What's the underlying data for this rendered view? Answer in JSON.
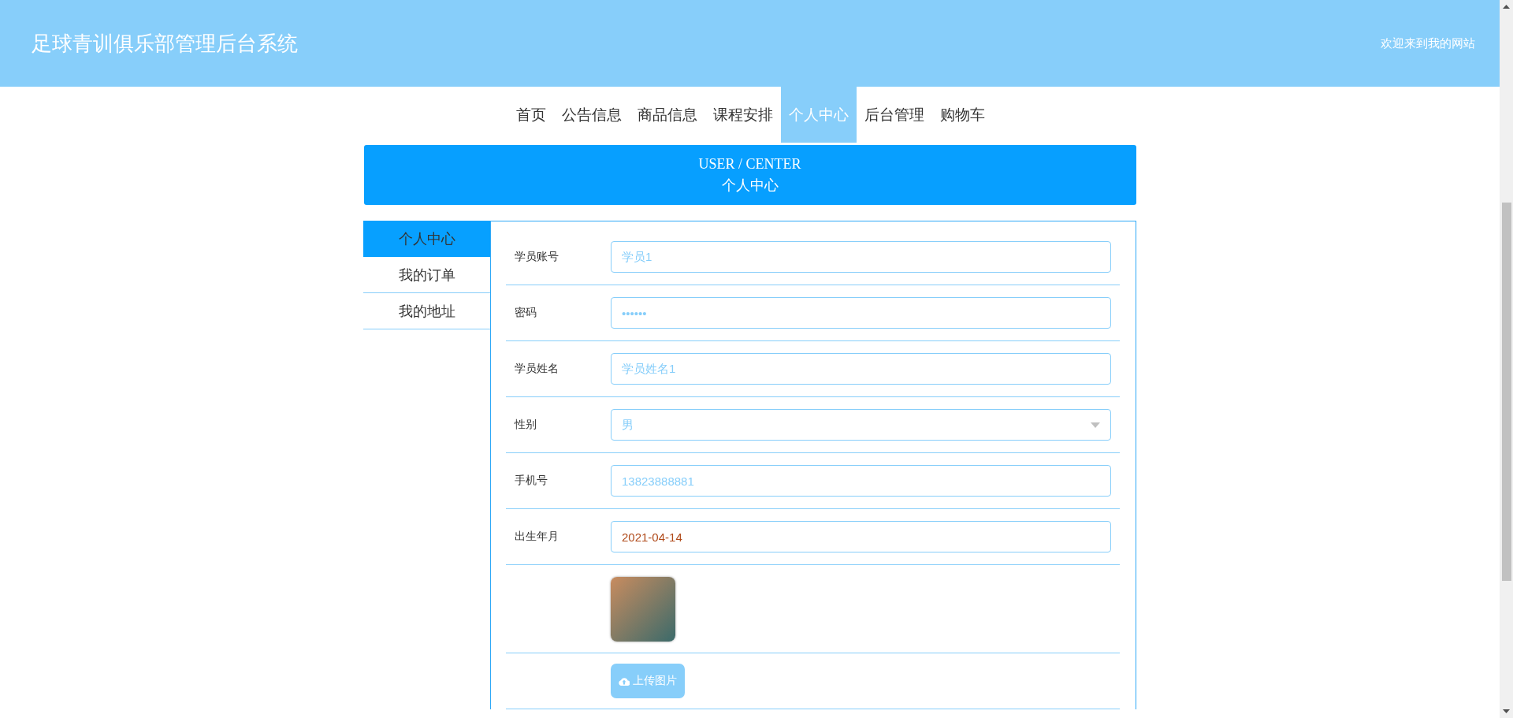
{
  "header": {
    "title": "足球青训俱乐部管理后台系统",
    "welcome": "欢迎来到我的网站"
  },
  "nav": [
    {
      "label": "首页",
      "selected": false
    },
    {
      "label": "公告信息",
      "selected": false
    },
    {
      "label": "商品信息",
      "selected": false
    },
    {
      "label": "课程安排",
      "selected": false
    },
    {
      "label": "个人中心",
      "selected": true
    },
    {
      "label": "后台管理",
      "selected": false
    },
    {
      "label": "购物车",
      "selected": false
    }
  ],
  "banner": {
    "title": "USER / CENTER",
    "subtitle": "个人中心"
  },
  "sidebar": {
    "items": [
      {
        "label": "个人中心",
        "selected": true
      },
      {
        "label": "我的订单",
        "selected": false
      },
      {
        "label": "我的地址",
        "selected": false
      }
    ]
  },
  "form": {
    "fields": [
      {
        "kind": "text",
        "label": "学员账号",
        "value": "学员1"
      },
      {
        "kind": "text",
        "label": "密码",
        "value": "••••••"
      },
      {
        "kind": "text",
        "label": "学员姓名",
        "value": "学员姓名1"
      },
      {
        "kind": "select",
        "label": "性别",
        "value": "男"
      },
      {
        "kind": "text",
        "label": "手机号",
        "value": "13823888881"
      },
      {
        "kind": "date",
        "label": "出生年月",
        "value": "2021-04-14"
      }
    ],
    "upload_button": "上传图片"
  }
}
